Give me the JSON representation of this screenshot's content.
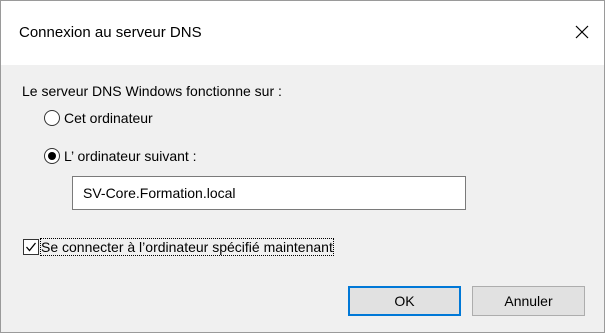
{
  "dialog": {
    "title": "Connexion au serveur DNS",
    "prompt": "Le serveur DNS Windows fonctionne sur :",
    "options": [
      {
        "label": "Cet ordinateur",
        "selected": false
      },
      {
        "label": "L’ ordinateur suivant :",
        "selected": true
      }
    ],
    "server_name": "SV-Core.Formation.local",
    "connect_now": {
      "label": "Se connecter à l’ordinateur spécifié maintenant",
      "checked": true
    },
    "ok_label": "OK",
    "cancel_label": "Annuler",
    "close_icon": "close-icon"
  },
  "colors": {
    "dialog_bg": "#f0f0f0",
    "titlebar_bg": "#ffffff",
    "default_button_border": "#0078d7"
  }
}
